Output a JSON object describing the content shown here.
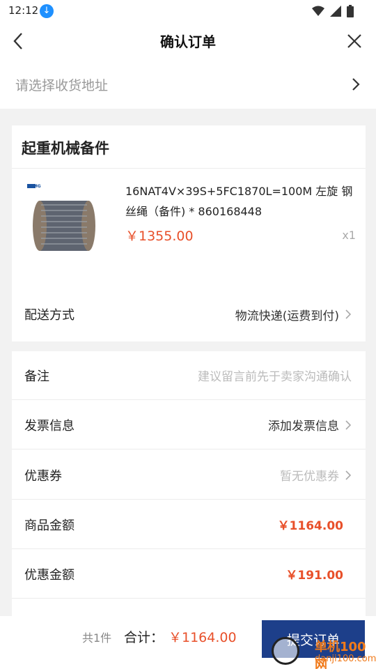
{
  "status": {
    "time": "12:12"
  },
  "header": {
    "title": "确认订单"
  },
  "address": {
    "placeholder": "请选择收货地址"
  },
  "shop": {
    "name": "起重机械备件"
  },
  "product": {
    "name": "16NAT4V×39S+5FC1870L=100M 左旋 钢丝绳（备件) * 860168448",
    "price": "￥1355.00",
    "qty": "x1",
    "logo_text": "XCMG"
  },
  "shipping": {
    "label": "配送方式",
    "value": "物流快递(运费到付)"
  },
  "form": {
    "remark_label": "备注",
    "remark_placeholder": "建议留言前先于卖家沟通确认",
    "invoice_label": "发票信息",
    "invoice_value": "添加发票信息",
    "coupon_label": "优惠券",
    "coupon_value": "暂无优惠券",
    "amount_label": "商品金额",
    "amount_value": "￥1164.00",
    "discount_label": "优惠金额",
    "discount_value": "￥191.00"
  },
  "bottom": {
    "count": "共1件",
    "total_label": "合计：",
    "total_value": "￥1164.00",
    "submit_label": "提交订单"
  },
  "watermark": {
    "text": "单机100网",
    "sub": "danji100.com"
  },
  "colors": {
    "accent": "#1d3f8a",
    "price": "#e8502a"
  }
}
